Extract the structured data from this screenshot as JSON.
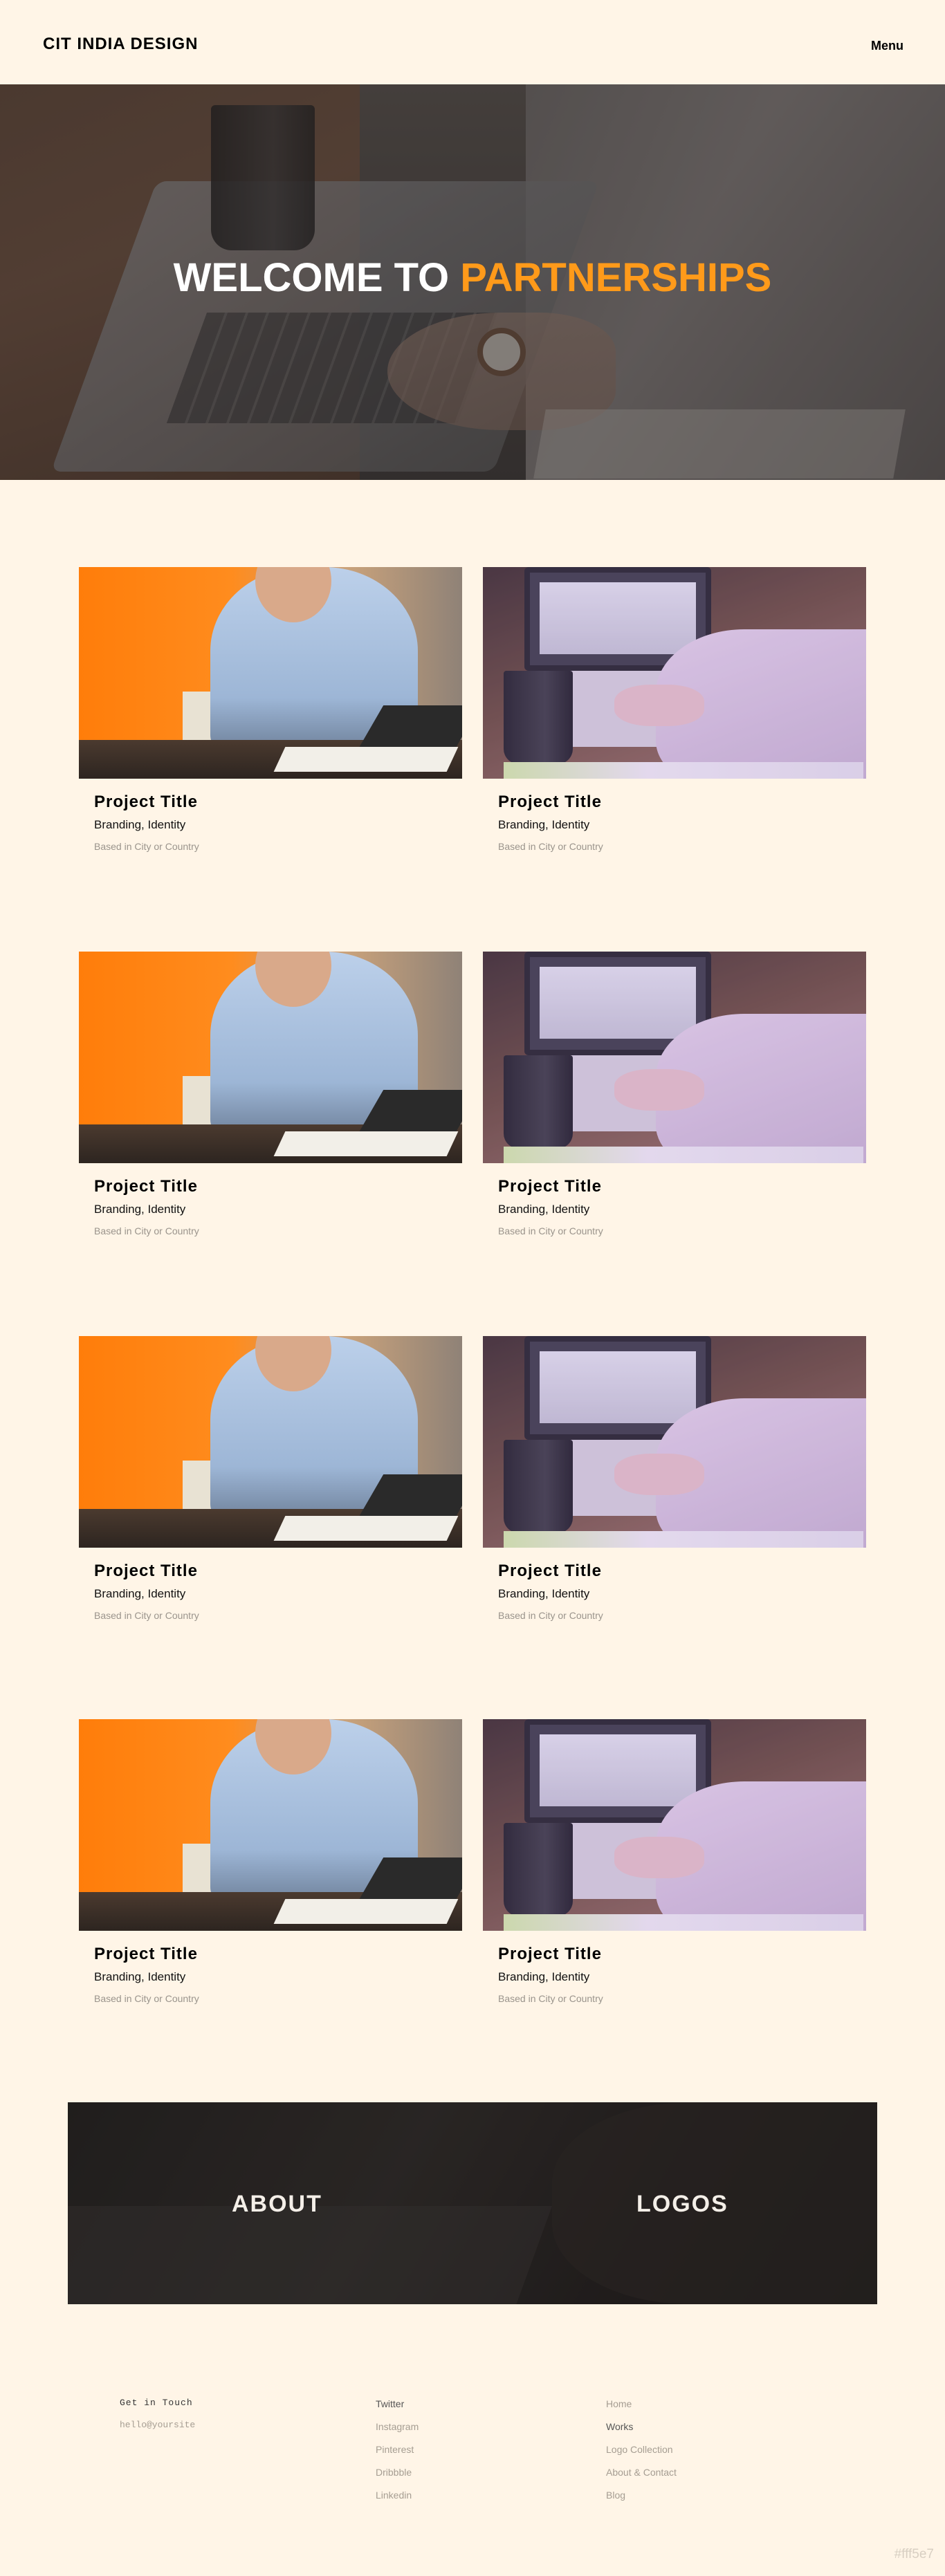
{
  "header": {
    "logo": "CIT INDIA DESIGN",
    "menu_label": "Menu"
  },
  "hero": {
    "title_plain": "WELCOME TO",
    "title_highlight": "PARTNERSHIPS",
    "highlight_color": "#ff9a1a"
  },
  "projects": [
    {
      "title": "Project Title",
      "subtitle": "Branding, Identity",
      "meta": "Based in City or Country"
    },
    {
      "title": "Project Title",
      "subtitle": "Branding, Identity",
      "meta": "Based in City or Country"
    },
    {
      "title": "Project Title",
      "subtitle": "Branding, Identity",
      "meta": "Based in City or Country"
    },
    {
      "title": "Project Title",
      "subtitle": "Branding, Identity",
      "meta": "Based in City or Country"
    },
    {
      "title": "Project Title",
      "subtitle": "Branding, Identity",
      "meta": "Based in City or Country"
    },
    {
      "title": "Project Title",
      "subtitle": "Branding, Identity",
      "meta": "Based in City or Country"
    },
    {
      "title": "Project Title",
      "subtitle": "Branding, Identity",
      "meta": "Based in City or Country"
    },
    {
      "title": "Project Title",
      "subtitle": "Branding, Identity",
      "meta": "Based in City or Country"
    }
  ],
  "banner": {
    "about_label": "ABOUT",
    "logos_label": "LOGOS"
  },
  "footer": {
    "contact_title": "Get in Touch",
    "contact_email": "hello@yoursite",
    "social": [
      "Twitter",
      "Instagram",
      "Pinterest",
      "Dribbble",
      "Linkedin"
    ],
    "nav": [
      "Home",
      "Works",
      "Logo Collection",
      "About & Contact",
      "Blog"
    ]
  },
  "corner_tag": "#fff5e7",
  "colors": {
    "background": "#fff5e7",
    "accent": "#ff9a1a"
  }
}
